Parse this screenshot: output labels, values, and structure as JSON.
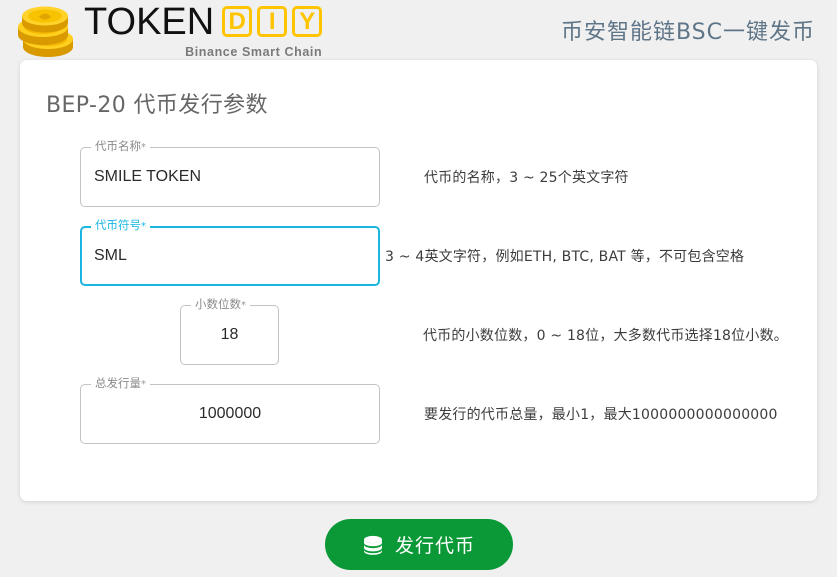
{
  "header": {
    "logo": {
      "icon": "coin-stack-icon",
      "word_mark": "TOKEN",
      "diy_letters": [
        "D",
        "I",
        "Y"
      ],
      "tagline": "Binance Smart Chain",
      "gold_color": "#ffc400"
    },
    "title": "币安智能链BSC一键发币",
    "title_color": "#5f7588"
  },
  "card": {
    "title": "BEP-20 代币发行参数",
    "fields": [
      {
        "label": "代币名称",
        "required_mark": "*",
        "value": "SMILE TOKEN",
        "hint": "代币的名称，3 ~ 25个英文字符",
        "focused": false,
        "align": "left"
      },
      {
        "label": "代币符号",
        "required_mark": "*",
        "value": "SML",
        "hint": "3 ~ 4英文字符，例如ETH, BTC, BAT 等，不可包含空格",
        "focused": true,
        "align": "left"
      },
      {
        "label": "小数位数",
        "required_mark": "*",
        "value": "18",
        "hint": "代币的小数位数，0 ~ 18位，大多数代币选择18位小数。",
        "focused": false,
        "align": "center"
      },
      {
        "label": "总发行量",
        "required_mark": "*",
        "value": "1000000",
        "hint": "要发行的代币总量，最小1，最大1000000000000000",
        "focused": false,
        "align": "center"
      }
    ]
  },
  "submit": {
    "label": "发行代币",
    "icon": "coins-stack-icon",
    "color": "#0a9936"
  },
  "focus_color": "#18b6e0"
}
